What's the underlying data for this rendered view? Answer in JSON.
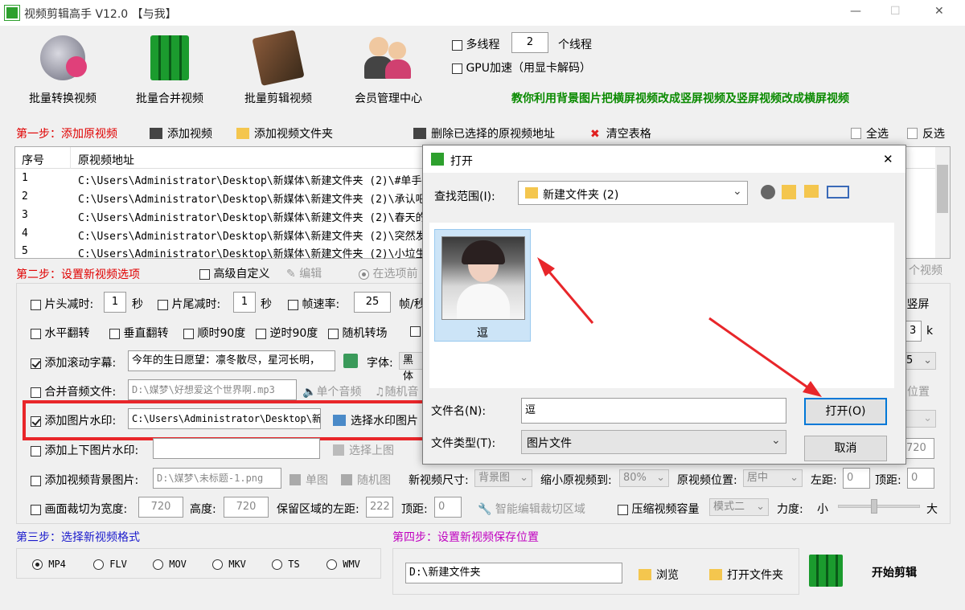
{
  "window": {
    "title": "视频剪辑高手 V12.0 【与我】",
    "min": "—",
    "max": "☐",
    "close": "✕"
  },
  "toolbar": [
    {
      "label": "批量转换视频"
    },
    {
      "label": "批量合并视频"
    },
    {
      "label": "批量剪辑视频"
    },
    {
      "label": "会员管理中心"
    }
  ],
  "options": {
    "multithread_label": "多线程",
    "threads_value": "2",
    "threads_unit": "个线程",
    "gpu_label": "GPU加速（用显卡解码）"
  },
  "promo": "教你利用背景图片把横屏视频改成竖屏视频及竖屏视频改成横屏视频",
  "step1": {
    "title": "第一步：添加原视频",
    "add_video": "添加视频",
    "add_folder": "添加视频文件夹",
    "delete_selected": "删除已选择的原视频地址",
    "clear_table": "清空表格",
    "select_all": "全选",
    "invert": "反选"
  },
  "table": {
    "col_index": "序号",
    "col_path": "原视频地址",
    "rows": [
      {
        "n": "1",
        "path": "C:\\Users\\Administrator\\Desktop\\新媒体\\新建文件夹 (2)\\#单手抱"
      },
      {
        "n": "2",
        "path": "C:\\Users\\Administrator\\Desktop\\新媒体\\新建文件夹 (2)\\承认吧你"
      },
      {
        "n": "3",
        "path": "C:\\Users\\Administrator\\Desktop\\新媒体\\新建文件夹 (2)\\春天的理"
      },
      {
        "n": "4",
        "path": "C:\\Users\\Administrator\\Desktop\\新媒体\\新建文件夹 (2)\\突然发现"
      },
      {
        "n": "5",
        "path": "C:\\Users\\Administrator\\Desktop\\新媒体\\新建文件夹 (2)\\小垃生病"
      }
    ]
  },
  "step2": {
    "title": "第二步：设置新视频选项",
    "advanced": "高级自定义",
    "edit": "编辑",
    "in_options": "在选项前",
    "video_count": "个视频",
    "cut_head": "片头减时:",
    "cut_head_val": "1",
    "sec": "秒",
    "cut_tail": "片尾减时:",
    "cut_tail_val": "1",
    "sec2": "秒",
    "fps": "帧速率:",
    "fps_val": "25",
    "fps_unit": "帧/秒",
    "flip_h": "水平翻转",
    "flip_v": "垂直翻转",
    "rot_cw": "顺时90度",
    "rot_ccw": "逆时90度",
    "rand_rot": "随机转场",
    "portrait": "竖屏",
    "k": "k",
    "k_val": "3",
    "scroll_label": "添加滚动字幕:",
    "scroll_text": "今年的生日愿望：凛冬散尽，星河长明，",
    "font_label": "字体:",
    "font_val": "黑体",
    "size_val": "5",
    "audio_label": "合并音频文件:",
    "audio_path": "D:\\媒梦\\好想爱这个世界啊.mp3",
    "single_audio": "单个音频",
    "random_audio": "随机音",
    "pos_label": "位置",
    "watermark_label": "添加图片水印:",
    "watermark_path": "C:\\Users\\Administrator\\Desktop\\新媒",
    "choose_watermark": "选择水印图片",
    "updown_label": "添加上下图片水印:",
    "choose_top": "选择上图",
    "w720": "720",
    "bg_label": "添加视频背景图片:",
    "bg_path": "D:\\媒梦\\未标题-1.png",
    "single_img": "单图",
    "random_img": "随机图",
    "new_size_label": "新视频尺寸:",
    "new_size_val": "背景图",
    "shrink_label": "缩小原视频到:",
    "shrink_val": "80%",
    "orig_pos_label": "原视频位置:",
    "orig_pos_val": "居中",
    "left_label": "左距:",
    "left_val": "0",
    "top_label": "顶距:",
    "top_val": "0",
    "crop_label": "画面裁切为宽度:",
    "crop_w": "720",
    "height_label": "高度:",
    "crop_h": "720",
    "keep_left_label": "保留区域的左距:",
    "keep_left": "222",
    "keep_top_label": "顶距:",
    "keep_top": "0",
    "smart_crop": "智能编辑裁切区域",
    "compress_label": "压缩视频容量",
    "mode_val": "模式二",
    "force_label": "力度:",
    "small": "小",
    "big": "大"
  },
  "step3": {
    "title": "第三步：选择新视频格式",
    "formats": [
      "MP4",
      "FLV",
      "MOV",
      "MKV",
      "TS",
      "WMV"
    ],
    "selected": "MP4"
  },
  "step4": {
    "title": "第四步：设置新视频保存位置",
    "path": "D:\\新建文件夹",
    "browse": "浏览",
    "open_folder": "打开文件夹",
    "start": "开始剪辑"
  },
  "dialog": {
    "title": "打开",
    "close": "✕",
    "look_in_label": "查找范围(I):",
    "look_in_val": "新建文件夹 (2)",
    "file_name": "逗",
    "filename_label": "文件名(N):",
    "filename_val": "逗",
    "filetype_label": "文件类型(T):",
    "filetype_val": "图片文件",
    "open_btn": "打开(O)",
    "cancel_btn": "取消"
  },
  "colors": {
    "step_red": "#e00000",
    "step_magenta": "#c000c0",
    "promo_green": "#0a8a00",
    "highlight_red": "#e8262a",
    "selection_blue": "#cce4f7"
  }
}
